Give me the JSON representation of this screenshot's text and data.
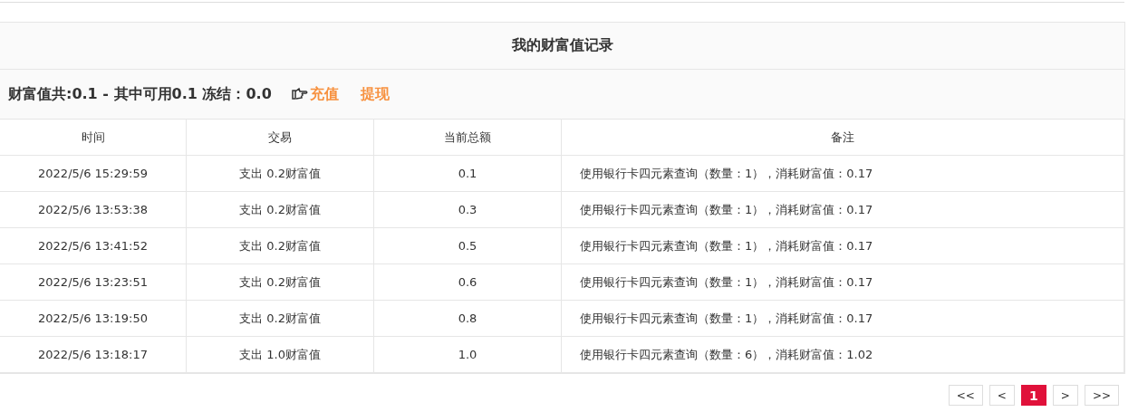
{
  "panel": {
    "title": "我的财富值记录"
  },
  "summary": {
    "text": "财富值共:0.1 - 其中可用0.1 冻结：0.0",
    "links": [
      {
        "label": "充值",
        "icon": true
      },
      {
        "label": "提现",
        "icon": false
      }
    ]
  },
  "table": {
    "columns": [
      "时间",
      "交易",
      "当前总额",
      "备注"
    ],
    "rows": [
      [
        "2022/5/6 15:29:59",
        "支出 0.2财富值",
        "0.1",
        "使用银行卡四元素查询（数量：1），消耗财富值：0.17"
      ],
      [
        "2022/5/6 13:53:38",
        "支出 0.2财富值",
        "0.3",
        "使用银行卡四元素查询（数量：1），消耗财富值：0.17"
      ],
      [
        "2022/5/6 13:41:52",
        "支出 0.2财富值",
        "0.5",
        "使用银行卡四元素查询（数量：1），消耗财富值：0.17"
      ],
      [
        "2022/5/6 13:23:51",
        "支出 0.2财富值",
        "0.6",
        "使用银行卡四元素查询（数量：1），消耗财富值：0.17"
      ],
      [
        "2022/5/6 13:19:50",
        "支出 0.2财富值",
        "0.8",
        "使用银行卡四元素查询（数量：1），消耗财富值：0.17"
      ],
      [
        "2022/5/6 13:18:17",
        "支出 1.0财富值",
        "1.0",
        "使用银行卡四元素查询（数量：6），消耗财富值：1.02"
      ]
    ]
  },
  "pagination": [
    {
      "label": "<<",
      "selected": false
    },
    {
      "label": "<",
      "selected": false
    },
    {
      "label": "1",
      "selected": true
    },
    {
      "label": ">",
      "selected": false
    },
    {
      "label": ">>",
      "selected": false
    }
  ]
}
